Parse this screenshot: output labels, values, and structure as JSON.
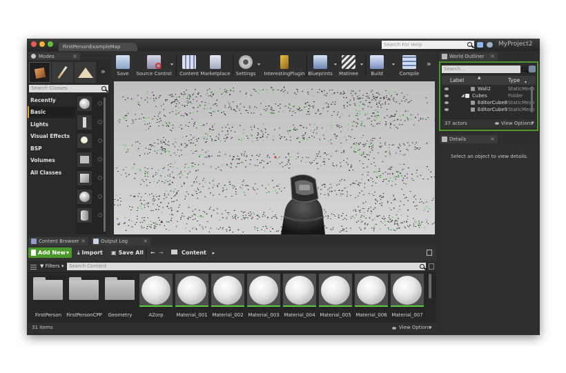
{
  "window": {
    "map_tab": "FirstPersonExampleMap",
    "help_search_placeholder": "Search For Help",
    "project_name": "MyProject2"
  },
  "modes": {
    "tab_label": "Modes",
    "search_placeholder": "Search Classes",
    "categories": [
      "Recently Placed",
      "Basic",
      "Lights",
      "Visual Effects",
      "BSP",
      "Volumes",
      "All Classes"
    ],
    "selected_category": "Basic"
  },
  "toolbar": {
    "items": [
      {
        "label": "Save",
        "icon": "save-icon"
      },
      {
        "label": "Source Control",
        "icon": "source-control-icon"
      },
      {
        "label": "Content",
        "icon": "content-icon"
      },
      {
        "label": "Marketplace",
        "icon": "marketplace-icon"
      },
      {
        "label": "Settings",
        "icon": "settings-icon"
      },
      {
        "label": "InterestingPlugin",
        "icon": "plugin-icon"
      },
      {
        "label": "Blueprints",
        "icon": "blueprints-icon"
      },
      {
        "label": "Matinee",
        "icon": "matinee-icon"
      },
      {
        "label": "Build",
        "icon": "build-icon"
      },
      {
        "label": "Compile",
        "icon": "compile-icon"
      }
    ]
  },
  "outliner": {
    "tab_label": "World Outliner",
    "search_placeholder": "Search...",
    "col_label": "Label",
    "col_type": "Type",
    "rows": [
      {
        "label": "Wall2",
        "type": "StaticMesh"
      },
      {
        "label": "Cubes",
        "type": "Folder"
      },
      {
        "label": "EditorCube8",
        "type": "StaticMesh"
      },
      {
        "label": "EditorCube9",
        "type": "StaticMesh"
      }
    ],
    "actor_count": "37 actors",
    "view_options": "View Options"
  },
  "details": {
    "tab_label": "Details",
    "empty_message": "Select an object to view details."
  },
  "content_browser": {
    "tab_label": "Content Browser",
    "output_tab_label": "Output Log",
    "add_new": "Add New",
    "import": "Import",
    "save_all": "Save All",
    "path": "Content",
    "filters": "Filters",
    "search_placeholder": "Search Content",
    "assets": [
      {
        "name": "FirstPerson",
        "kind": "folder"
      },
      {
        "name": "FirstPersonCPP",
        "kind": "folder"
      },
      {
        "name": "Geometry",
        "kind": "folder"
      },
      {
        "name": "AZorp",
        "kind": "material"
      },
      {
        "name": "Material_001",
        "kind": "material"
      },
      {
        "name": "Material_002",
        "kind": "material"
      },
      {
        "name": "Material_003",
        "kind": "material"
      },
      {
        "name": "Material_004",
        "kind": "material"
      },
      {
        "name": "Material_005",
        "kind": "material"
      },
      {
        "name": "Material_006",
        "kind": "material"
      },
      {
        "name": "Material_007",
        "kind": "material"
      }
    ],
    "item_count": "31 items",
    "view_options": "View Options"
  },
  "colors": {
    "accent_green": "#4a9a2a",
    "panel_dark": "#2e2e2e",
    "outliner_border": "#4e9a2c"
  }
}
